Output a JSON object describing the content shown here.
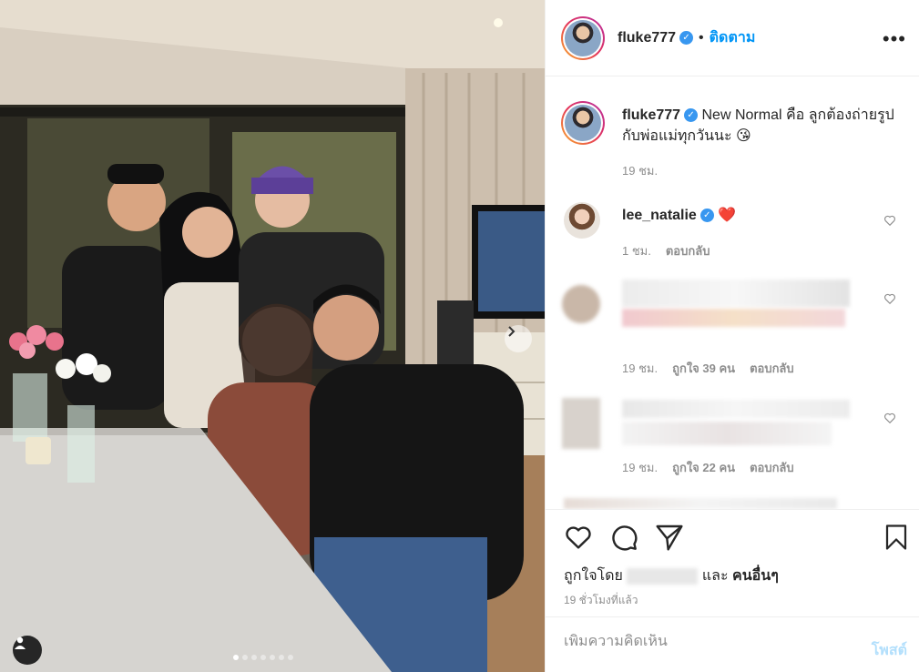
{
  "post": {
    "username": "fluke777",
    "follow_label": "ติดตาม",
    "separator": "•",
    "more_label": "•••",
    "slide_count": 7,
    "active_slide": 1
  },
  "caption": {
    "username": "fluke777",
    "text": "New Normal คือ ลูกต้องถ่ายรูปกับพ่อแม่ทุกวันนะ 😘",
    "time": "19 ชม."
  },
  "comments": [
    {
      "username": "lee_natalie",
      "text": "❤️",
      "time": "1 ชม.",
      "likes": "",
      "reply_label": "ตอบกลับ"
    },
    {
      "username": "",
      "text": "",
      "time": "19 ชม.",
      "likes": "ถูกใจ 39 คน",
      "reply_label": "ตอบกลับ"
    },
    {
      "username": "",
      "text": "",
      "time": "19 ชม.",
      "likes": "ถูกใจ 22 คน",
      "reply_label": "ตอบกลับ"
    }
  ],
  "likes_line": {
    "prefix": "ถูกใจโดย",
    "and": "และ",
    "others": "คนอื่นๆ"
  },
  "timestamp": "19 ชั่วโมงที่แล้ว",
  "add_comment": {
    "placeholder": "เพิ่มความคิดเห็น",
    "post_label": "โพสต์"
  },
  "colors": {
    "accent": "#0095f6",
    "verified": "#3897f0",
    "heart": "#ed4956",
    "post_disabled": "#b2dffc"
  },
  "icons": [
    "heart-icon",
    "comment-icon",
    "share-icon",
    "bookmark-icon",
    "chevron-right-icon",
    "user-tag-icon",
    "more-icon",
    "verified-icon"
  ]
}
